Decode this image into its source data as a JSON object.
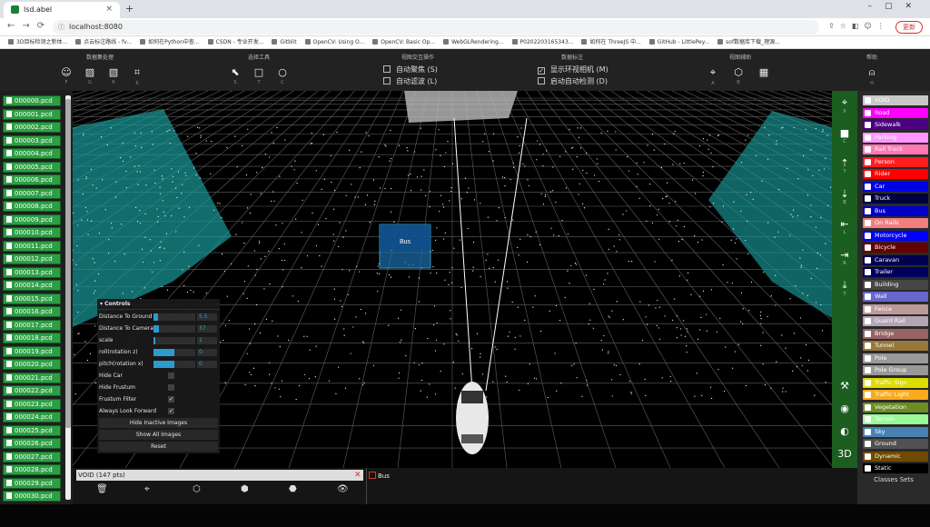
{
  "browser": {
    "tab_title": "lsd.abel",
    "url": "localhost:8080",
    "update_label": "更新",
    "bookmarks": [
      "3D目标检测之新体...",
      "点云标注路线 - fv...",
      "如何在Python中查...",
      "CSDN - 专业开发...",
      "Gitblit",
      "OpenCV: Using O...",
      "OpenCV: Basic Op...",
      "WebGLRendering...",
      "P0202203165343...",
      "如何在 ThreeJS 中...",
      "GitHub - LittlePey...",
      "sof数据库下载_理源..."
    ]
  },
  "toolbar": {
    "groups": [
      {
        "title": "数据集处理",
        "tools": [
          {
            "icon": "☺",
            "key": "F"
          },
          {
            "icon": "▨",
            "key": "G"
          },
          {
            "icon": "▧",
            "key": "R"
          },
          {
            "icon": "⌗",
            "key": "K"
          }
        ]
      },
      {
        "title": "选择工具",
        "tools": [
          {
            "icon": "⬉",
            "key": "S"
          },
          {
            "icon": "□",
            "key": "T"
          },
          {
            "icon": "○",
            "key": "C"
          }
        ]
      },
      {
        "title": "视图交互操作",
        "checks": [
          {
            "label": "自动聚焦 (S)",
            "checked": false
          },
          {
            "label": "自动滤波 (L)",
            "checked": false
          }
        ]
      },
      {
        "title": "数据标注",
        "checks": [
          {
            "label": "显示环视相机 (M)",
            "checked": true
          },
          {
            "label": "启动自动检测 (D)",
            "checked": false
          }
        ]
      },
      {
        "title": "视图辅助",
        "tools": [
          {
            "icon": "⌖",
            "key": "A"
          },
          {
            "icon": "⬡",
            "key": "B"
          },
          {
            "icon": "▦",
            "key": ""
          }
        ]
      },
      {
        "title": "帮助",
        "tools": [
          {
            "icon": "⍝",
            "key": "H"
          }
        ]
      }
    ]
  },
  "files": [
    "000000.pcd",
    "000001.pcd",
    "000002.pcd",
    "000003.pcd",
    "000004.pcd",
    "000005.pcd",
    "000006.pcd",
    "000007.pcd",
    "000008.pcd",
    "000009.pcd",
    "000010.pcd",
    "000011.pcd",
    "000012.pcd",
    "000013.pcd",
    "000014.pcd",
    "000015.pcd",
    "000016.pcd",
    "000017.pcd",
    "000018.pcd",
    "000019.pcd",
    "000020.pcd",
    "000021.pcd",
    "000022.pcd",
    "000023.pcd",
    "000024.pcd",
    "000025.pcd",
    "000026.pcd",
    "000027.pcd",
    "000028.pcd",
    "000029.pcd",
    "000030.pcd"
  ],
  "viewport": {
    "box_label": "Bus"
  },
  "controls": {
    "title": "Controls",
    "sliders": [
      {
        "label": "Distance To Ground",
        "value": "5.5",
        "fill": 0.1
      },
      {
        "label": "Distance To Camera",
        "value": "37",
        "fill": 0.12
      },
      {
        "label": "scale",
        "value": "1",
        "fill": 0.05
      },
      {
        "label": "roll(rotation z)",
        "value": "0",
        "fill": 0.5
      },
      {
        "label": "pitch(rotation x)",
        "value": "0",
        "fill": 0.5
      }
    ],
    "checks": [
      {
        "label": "Hide Car",
        "checked": false
      },
      {
        "label": "Hide Frustum",
        "checked": false
      },
      {
        "label": "Frustum Filter",
        "checked": true
      },
      {
        "label": "Always Look Forward",
        "checked": true
      }
    ],
    "buttons": [
      "Hide Inactive Images",
      "Show All Images",
      "Reset"
    ]
  },
  "side_tools": [
    {
      "icon": "⌖",
      "key": "X"
    },
    {
      "icon": "■",
      "key": "C"
    },
    {
      "icon": "⇡",
      "key": "Y"
    },
    {
      "icon": "⇣",
      "key": "B"
    },
    {
      "icon": "⇤",
      "key": "L"
    },
    {
      "icon": "⇥",
      "key": "R"
    },
    {
      "icon": "⤓",
      "key": "T"
    },
    {
      "icon": "⚒",
      "key": ""
    },
    {
      "icon": "◉",
      "key": ""
    },
    {
      "icon": "◐",
      "key": ""
    },
    {
      "icon": "3D",
      "key": ""
    }
  ],
  "bottom": {
    "selection": "VOID (147 pts)",
    "object_label": "Bus",
    "tools": [
      "🗑",
      "⌖",
      "⬡",
      "⬢",
      "⬣",
      "👁"
    ]
  },
  "classes": {
    "title": "Classes Sets",
    "items": [
      {
        "name": "VOID",
        "color": "#c8c8c8"
      },
      {
        "name": "Road",
        "color": "#ff00ff"
      },
      {
        "name": "Sidewalk",
        "color": "#4b0082"
      },
      {
        "name": "Parking",
        "color": "#ff96ff"
      },
      {
        "name": "Rail Track",
        "color": "#ff78b4"
      },
      {
        "name": "Person",
        "color": "#ff1e1e"
      },
      {
        "name": "Rider",
        "color": "#ff0000"
      },
      {
        "name": "Car",
        "color": "#0000e6"
      },
      {
        "name": "Truck",
        "color": "#00003c"
      },
      {
        "name": "Bus",
        "color": "#0000c8"
      },
      {
        "name": "On Rails",
        "color": "#f08080"
      },
      {
        "name": "Motorcycle",
        "color": "#0000ff"
      },
      {
        "name": "Bicycle",
        "color": "#640000"
      },
      {
        "name": "Caravan",
        "color": "#000050"
      },
      {
        "name": "Trailer",
        "color": "#00005a"
      },
      {
        "name": "Building",
        "color": "#464646"
      },
      {
        "name": "Wall",
        "color": "#6666cc"
      },
      {
        "name": "Fence",
        "color": "#be9999"
      },
      {
        "name": "Guard Rail",
        "color": "#b4a5b4"
      },
      {
        "name": "Bridge",
        "color": "#966464"
      },
      {
        "name": "Tunnel",
        "color": "#96783c"
      },
      {
        "name": "Pole",
        "color": "#999999"
      },
      {
        "name": "Pole Group",
        "color": "#999999"
      },
      {
        "name": "Traffic Sign",
        "color": "#dcdc00"
      },
      {
        "name": "Traffic Light",
        "color": "#faaa1e"
      },
      {
        "name": "Vegetation",
        "color": "#6b8e23"
      },
      {
        "name": "Terrain",
        "color": "#98fb98"
      },
      {
        "name": "Sky",
        "color": "#4682b4"
      },
      {
        "name": "Ground",
        "color": "#515151"
      },
      {
        "name": "Dynamic",
        "color": "#6f4a00"
      },
      {
        "name": "Static",
        "color": "#000000"
      }
    ]
  }
}
